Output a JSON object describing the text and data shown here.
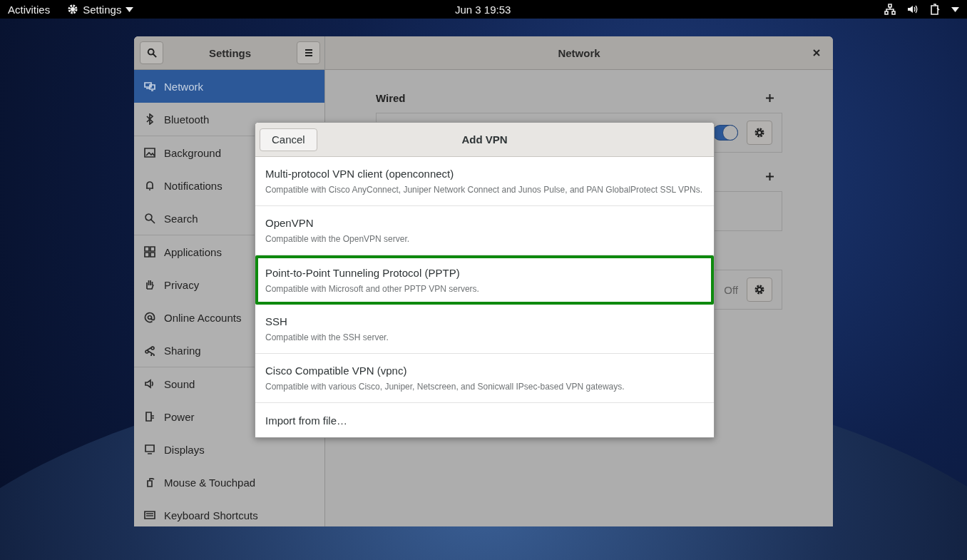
{
  "top_bar": {
    "activities": "Activities",
    "app_menu": "Settings",
    "clock": "Jun 3  19:53"
  },
  "window": {
    "sidebar_title": "Settings",
    "title": "Network"
  },
  "sidebar": {
    "groups": [
      {
        "items": [
          {
            "label": "Network",
            "selected": true
          },
          {
            "label": "Bluetooth",
            "selected": false
          }
        ]
      },
      {
        "items": [
          {
            "label": "Background",
            "selected": false
          },
          {
            "label": "Notifications",
            "selected": false
          },
          {
            "label": "Search",
            "selected": false
          }
        ]
      },
      {
        "items": [
          {
            "label": "Applications",
            "selected": false
          },
          {
            "label": "Privacy",
            "selected": false
          },
          {
            "label": "Online Accounts",
            "selected": false
          },
          {
            "label": "Sharing",
            "selected": false
          }
        ]
      },
      {
        "items": [
          {
            "label": "Sound",
            "selected": false
          },
          {
            "label": "Power",
            "selected": false
          },
          {
            "label": "Displays",
            "selected": false
          },
          {
            "label": "Mouse & Touchpad",
            "selected": false
          },
          {
            "label": "Keyboard Shortcuts",
            "selected": false
          }
        ]
      }
    ]
  },
  "network": {
    "sections": [
      {
        "title": "Wired",
        "add": true,
        "kind": "toggle",
        "on": true
      },
      {
        "add": true,
        "kind": "empty"
      },
      {
        "add": false,
        "kind": "status",
        "status": "Off"
      }
    ]
  },
  "dialog": {
    "cancel": "Cancel",
    "title": "Add VPN",
    "options": [
      {
        "title": "Multi-protocol VPN client (openconnect)",
        "description": "Compatible with Cisco AnyConnect, Juniper Network Connect and Junos Pulse, and PAN GlobalProtect SSL VPNs.",
        "highlighted": false
      },
      {
        "title": "OpenVPN",
        "description": "Compatible with the OpenVPN server.",
        "highlighted": false
      },
      {
        "title": "Point-to-Point Tunneling Protocol (PPTP)",
        "description": "Compatible with Microsoft and other PPTP VPN servers.",
        "highlighted": true
      },
      {
        "title": "SSH",
        "description": "Compatible with the SSH server.",
        "highlighted": false
      },
      {
        "title": "Cisco Compatible VPN (vpnc)",
        "description": "Compatible with various Cisco, Juniper, Netscreen, and Sonicwall IPsec-based VPN gateways.",
        "highlighted": false
      }
    ],
    "import": "Import from file…"
  }
}
